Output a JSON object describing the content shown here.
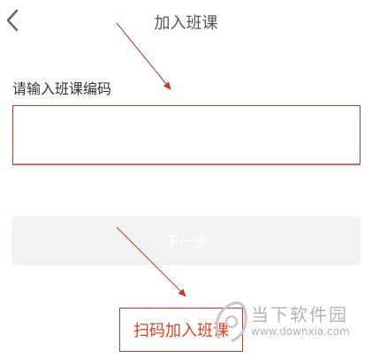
{
  "header": {
    "title": "加入班课",
    "back_icon": "chevron-left-icon"
  },
  "form": {
    "label": "请输入班课编码",
    "input_value": "",
    "input_placeholder": ""
  },
  "actions": {
    "next_label": "下一步",
    "scan_join_label": "扫码加入班课"
  },
  "watermark": {
    "name": "当下软件园",
    "url": "www.downxia.com"
  },
  "colors": {
    "annotation_red": "#c0392b",
    "scan_text": "#e0401e",
    "title_text": "#555555",
    "disabled_button_bg": "#f3f3f3"
  }
}
